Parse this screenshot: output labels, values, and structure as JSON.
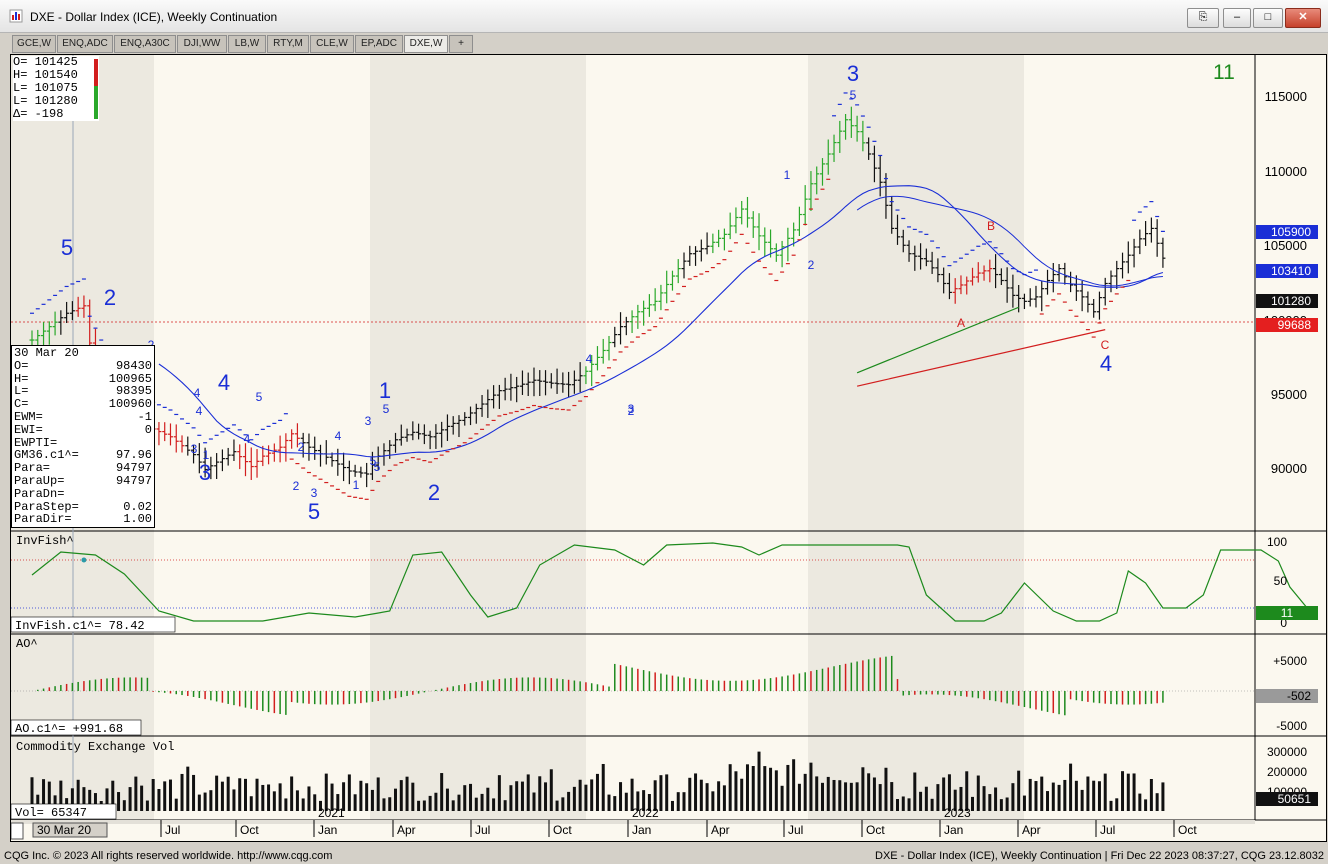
{
  "window": {
    "title": "DXE - Dollar Index (ICE), Weekly Continuation",
    "min": "–",
    "max": "□",
    "close": "✕",
    "link": "⎘"
  },
  "tabs": [
    {
      "label": "GCE,W"
    },
    {
      "label": "ENQ,ADC"
    },
    {
      "label": "ENQ,A30C"
    },
    {
      "label": "DJI,WW"
    },
    {
      "label": "LB,W"
    },
    {
      "label": "RTY,M"
    },
    {
      "label": "CLE,W"
    },
    {
      "label": "EP,ADC"
    },
    {
      "label": "DXE,W"
    },
    {
      "label": "+"
    }
  ],
  "ohlc": {
    "o": "O= 101425",
    "h": "H= 101540",
    "l": "L= 101075",
    "c": "L= 101280",
    "d": "Δ=   -198"
  },
  "cursor_box": {
    "date": "30 Mar 20",
    "rows": [
      [
        "O=",
        "98430"
      ],
      [
        "H=",
        "100965"
      ],
      [
        "L=",
        "98395"
      ],
      [
        "C=",
        "100960"
      ],
      [
        "EWM=",
        "-1"
      ],
      [
        "EWI=",
        "0"
      ],
      [
        "EWPTI=",
        ""
      ],
      [
        "GM36.c1^=",
        "97.96"
      ],
      [
        "Para=",
        "94797"
      ],
      [
        "ParaUp=",
        "94797"
      ],
      [
        "ParaDn=",
        ""
      ],
      [
        "ParaStep=",
        "0.02"
      ],
      [
        "ParaDir=",
        "1.00"
      ]
    ]
  },
  "price_axis": [
    "115000",
    "110000",
    "105000",
    "100000",
    "95000",
    "90000"
  ],
  "price_tags": {
    "blue1": "105900",
    "blue2": "103410",
    "last": "101280",
    "red": "99688",
    "count": "11"
  },
  "waves": {
    "w5a": "5",
    "w2a": "2",
    "w4a": "4",
    "w3a": "3",
    "w5b": "5",
    "w1": "1",
    "w2b": "2",
    "w3top": "3",
    "w4b": "4",
    "w5top": "5",
    "b": "B",
    "a": "A",
    "c": "C"
  },
  "subwaves": [
    "2",
    "4",
    "4",
    "5",
    "3",
    "1",
    "2",
    "4",
    "3",
    "5",
    "2",
    "3",
    "1",
    "5",
    "4",
    "2",
    "1",
    "2",
    "3",
    "4",
    "5",
    "3"
  ],
  "invfish": {
    "name": "InvFish^",
    "readout": "InvFish.c1^=   78.42",
    "axis": [
      "100",
      "50",
      "0"
    ],
    "tag": "11"
  },
  "ao": {
    "name": "AO^",
    "readout": "AO.c1^= +991.68",
    "axis": [
      "+5000",
      "-5000"
    ],
    "tag": "-502"
  },
  "vol": {
    "name": "Commodity Exchange Vol",
    "readout": "Vol=   65347",
    "axis": [
      "300000",
      "200000",
      "100000"
    ],
    "tag": "50651"
  },
  "time_axis": {
    "cursor": "30 Mar 20",
    "labels": [
      "Jul",
      "Oct",
      "Jan",
      "Apr",
      "Jul",
      "Oct",
      "Jan",
      "Apr",
      "Jul",
      "Oct",
      "Jan",
      "Apr",
      "Jul",
      "Oct"
    ],
    "years": [
      "2021",
      "2022",
      "2023"
    ]
  },
  "footer": {
    "left": "CQG Inc. © 2023 All rights reserved worldwide. http://www.cqg.com",
    "right": "DXE - Dollar Index (ICE), Weekly Continuation | Fri Dec 22 2023 08:37:27, CQG 23.12.8032"
  },
  "colors": {
    "up": "#2aa82a",
    "down": "#d21e1e",
    "blue": "#1a2ed6",
    "bg": "#fbf8ef",
    "shade": "#ece9e0"
  }
}
